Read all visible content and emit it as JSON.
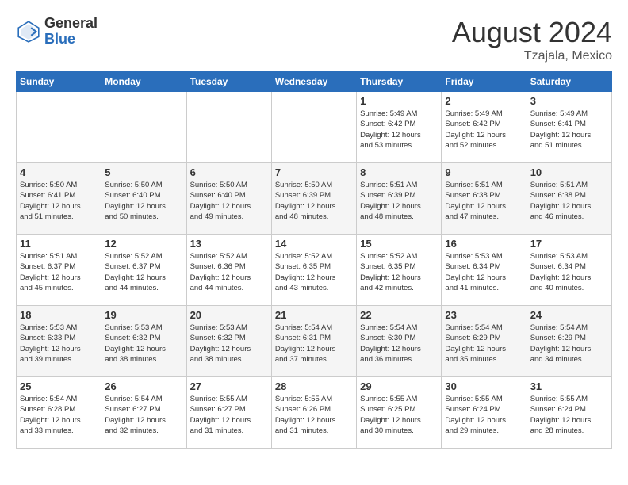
{
  "header": {
    "logo_general": "General",
    "logo_blue": "Blue",
    "month_year": "August 2024",
    "location": "Tzajala, Mexico"
  },
  "days_of_week": [
    "Sunday",
    "Monday",
    "Tuesday",
    "Wednesday",
    "Thursday",
    "Friday",
    "Saturday"
  ],
  "weeks": [
    {
      "days": [
        {
          "number": "",
          "info": ""
        },
        {
          "number": "",
          "info": ""
        },
        {
          "number": "",
          "info": ""
        },
        {
          "number": "",
          "info": ""
        },
        {
          "number": "1",
          "info": "Sunrise: 5:49 AM\nSunset: 6:42 PM\nDaylight: 12 hours\nand 53 minutes."
        },
        {
          "number": "2",
          "info": "Sunrise: 5:49 AM\nSunset: 6:42 PM\nDaylight: 12 hours\nand 52 minutes."
        },
        {
          "number": "3",
          "info": "Sunrise: 5:49 AM\nSunset: 6:41 PM\nDaylight: 12 hours\nand 51 minutes."
        }
      ]
    },
    {
      "days": [
        {
          "number": "4",
          "info": "Sunrise: 5:50 AM\nSunset: 6:41 PM\nDaylight: 12 hours\nand 51 minutes."
        },
        {
          "number": "5",
          "info": "Sunrise: 5:50 AM\nSunset: 6:40 PM\nDaylight: 12 hours\nand 50 minutes."
        },
        {
          "number": "6",
          "info": "Sunrise: 5:50 AM\nSunset: 6:40 PM\nDaylight: 12 hours\nand 49 minutes."
        },
        {
          "number": "7",
          "info": "Sunrise: 5:50 AM\nSunset: 6:39 PM\nDaylight: 12 hours\nand 48 minutes."
        },
        {
          "number": "8",
          "info": "Sunrise: 5:51 AM\nSunset: 6:39 PM\nDaylight: 12 hours\nand 48 minutes."
        },
        {
          "number": "9",
          "info": "Sunrise: 5:51 AM\nSunset: 6:38 PM\nDaylight: 12 hours\nand 47 minutes."
        },
        {
          "number": "10",
          "info": "Sunrise: 5:51 AM\nSunset: 6:38 PM\nDaylight: 12 hours\nand 46 minutes."
        }
      ]
    },
    {
      "days": [
        {
          "number": "11",
          "info": "Sunrise: 5:51 AM\nSunset: 6:37 PM\nDaylight: 12 hours\nand 45 minutes."
        },
        {
          "number": "12",
          "info": "Sunrise: 5:52 AM\nSunset: 6:37 PM\nDaylight: 12 hours\nand 44 minutes."
        },
        {
          "number": "13",
          "info": "Sunrise: 5:52 AM\nSunset: 6:36 PM\nDaylight: 12 hours\nand 44 minutes."
        },
        {
          "number": "14",
          "info": "Sunrise: 5:52 AM\nSunset: 6:35 PM\nDaylight: 12 hours\nand 43 minutes."
        },
        {
          "number": "15",
          "info": "Sunrise: 5:52 AM\nSunset: 6:35 PM\nDaylight: 12 hours\nand 42 minutes."
        },
        {
          "number": "16",
          "info": "Sunrise: 5:53 AM\nSunset: 6:34 PM\nDaylight: 12 hours\nand 41 minutes."
        },
        {
          "number": "17",
          "info": "Sunrise: 5:53 AM\nSunset: 6:34 PM\nDaylight: 12 hours\nand 40 minutes."
        }
      ]
    },
    {
      "days": [
        {
          "number": "18",
          "info": "Sunrise: 5:53 AM\nSunset: 6:33 PM\nDaylight: 12 hours\nand 39 minutes."
        },
        {
          "number": "19",
          "info": "Sunrise: 5:53 AM\nSunset: 6:32 PM\nDaylight: 12 hours\nand 38 minutes."
        },
        {
          "number": "20",
          "info": "Sunrise: 5:53 AM\nSunset: 6:32 PM\nDaylight: 12 hours\nand 38 minutes."
        },
        {
          "number": "21",
          "info": "Sunrise: 5:54 AM\nSunset: 6:31 PM\nDaylight: 12 hours\nand 37 minutes."
        },
        {
          "number": "22",
          "info": "Sunrise: 5:54 AM\nSunset: 6:30 PM\nDaylight: 12 hours\nand 36 minutes."
        },
        {
          "number": "23",
          "info": "Sunrise: 5:54 AM\nSunset: 6:29 PM\nDaylight: 12 hours\nand 35 minutes."
        },
        {
          "number": "24",
          "info": "Sunrise: 5:54 AM\nSunset: 6:29 PM\nDaylight: 12 hours\nand 34 minutes."
        }
      ]
    },
    {
      "days": [
        {
          "number": "25",
          "info": "Sunrise: 5:54 AM\nSunset: 6:28 PM\nDaylight: 12 hours\nand 33 minutes."
        },
        {
          "number": "26",
          "info": "Sunrise: 5:54 AM\nSunset: 6:27 PM\nDaylight: 12 hours\nand 32 minutes."
        },
        {
          "number": "27",
          "info": "Sunrise: 5:55 AM\nSunset: 6:27 PM\nDaylight: 12 hours\nand 31 minutes."
        },
        {
          "number": "28",
          "info": "Sunrise: 5:55 AM\nSunset: 6:26 PM\nDaylight: 12 hours\nand 31 minutes."
        },
        {
          "number": "29",
          "info": "Sunrise: 5:55 AM\nSunset: 6:25 PM\nDaylight: 12 hours\nand 30 minutes."
        },
        {
          "number": "30",
          "info": "Sunrise: 5:55 AM\nSunset: 6:24 PM\nDaylight: 12 hours\nand 29 minutes."
        },
        {
          "number": "31",
          "info": "Sunrise: 5:55 AM\nSunset: 6:24 PM\nDaylight: 12 hours\nand 28 minutes."
        }
      ]
    }
  ]
}
